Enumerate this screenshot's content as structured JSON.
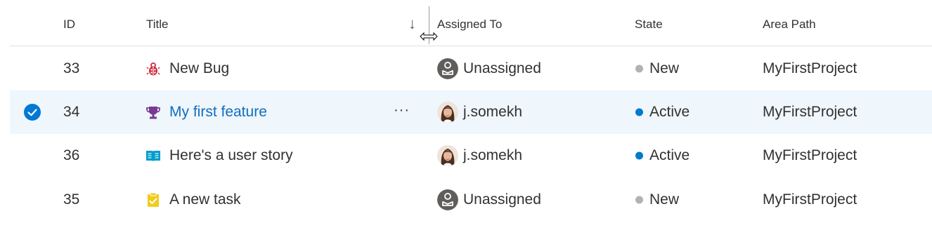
{
  "columns": {
    "id": "ID",
    "title": "Title",
    "assigned_to": "Assigned To",
    "state": "State",
    "area_path": "Area Path"
  },
  "sort": {
    "column": "Title",
    "direction": "descending",
    "arrow_glyph": "↓"
  },
  "more_glyph": "···",
  "rows": [
    {
      "id": "33",
      "type": "bug",
      "icon": "bug-icon",
      "icon_color": "#cc293d",
      "title": "New Bug",
      "assigned_to": "Unassigned",
      "assignee_avatar": "unassigned-avatar-icon",
      "state": "New",
      "state_color": "#b2b2b2",
      "area_path": "MyFirstProject",
      "selected": false
    },
    {
      "id": "34",
      "type": "feature",
      "icon": "trophy-icon",
      "icon_color": "#773b93",
      "title": "My first feature",
      "assigned_to": "j.somekh",
      "assignee_avatar": "user-avatar",
      "state": "Active",
      "state_color": "#007acc",
      "area_path": "MyFirstProject",
      "selected": true
    },
    {
      "id": "36",
      "type": "user-story",
      "icon": "book-icon",
      "icon_color": "#009ccc",
      "title": "Here's a user story",
      "assigned_to": "j.somekh",
      "assignee_avatar": "user-avatar",
      "state": "Active",
      "state_color": "#007acc",
      "area_path": "MyFirstProject",
      "selected": false
    },
    {
      "id": "35",
      "type": "task",
      "icon": "clipboard-check-icon",
      "icon_color": "#f2cb1d",
      "title": "A new task",
      "assigned_to": "Unassigned",
      "assignee_avatar": "unassigned-avatar-icon",
      "state": "New",
      "state_color": "#b2b2b2",
      "area_path": "MyFirstProject",
      "selected": false
    }
  ],
  "colors": {
    "selected_row_bg": "#eff6fc",
    "link": "#106ebe",
    "check_blue": "#0078d4",
    "header_border": "#e1dfdd"
  }
}
